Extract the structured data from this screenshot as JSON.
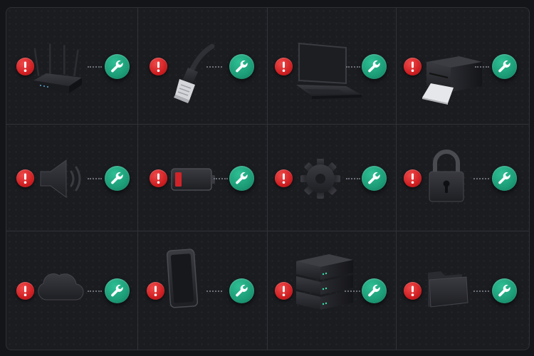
{
  "colors": {
    "alert": "#d4222a",
    "fix": "#1fa37e",
    "device": "#2b2c31",
    "background": "#1b1c20"
  },
  "tiles": [
    {
      "device": "router-icon",
      "status_icon": "exclamation-icon",
      "action_icon": "wrench-icon"
    },
    {
      "device": "ethernet-cable-icon",
      "status_icon": "exclamation-icon",
      "action_icon": "wrench-icon"
    },
    {
      "device": "laptop-icon",
      "status_icon": "exclamation-icon",
      "action_icon": "wrench-icon"
    },
    {
      "device": "printer-icon",
      "status_icon": "exclamation-icon",
      "action_icon": "wrench-icon"
    },
    {
      "device": "speaker-icon",
      "status_icon": "exclamation-icon",
      "action_icon": "wrench-icon"
    },
    {
      "device": "low-battery-icon",
      "status_icon": "exclamation-icon",
      "action_icon": "wrench-icon"
    },
    {
      "device": "gear-icon",
      "status_icon": "exclamation-icon",
      "action_icon": "wrench-icon"
    },
    {
      "device": "padlock-icon",
      "status_icon": "exclamation-icon",
      "action_icon": "wrench-icon"
    },
    {
      "device": "cloud-icon",
      "status_icon": "exclamation-icon",
      "action_icon": "wrench-icon"
    },
    {
      "device": "smartphone-icon",
      "status_icon": "exclamation-icon",
      "action_icon": "wrench-icon"
    },
    {
      "device": "server-rack-icon",
      "status_icon": "exclamation-icon",
      "action_icon": "wrench-icon"
    },
    {
      "device": "folder-icon",
      "status_icon": "exclamation-icon",
      "action_icon": "wrench-icon"
    }
  ]
}
